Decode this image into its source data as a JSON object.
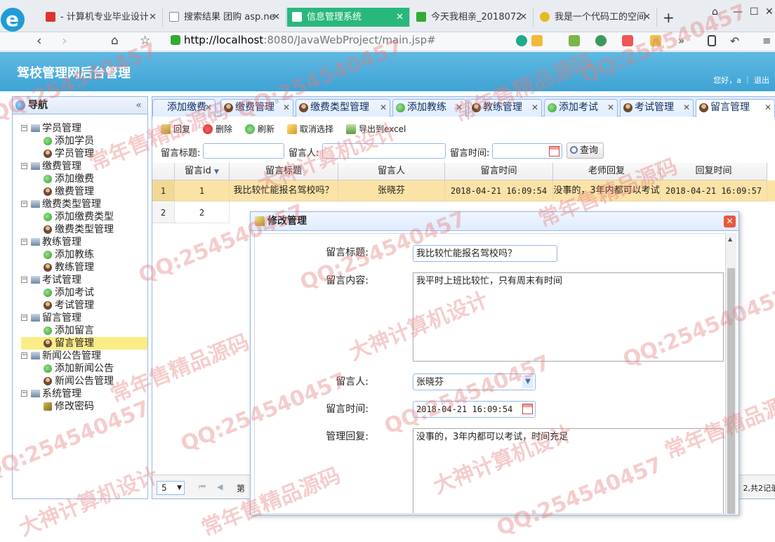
{
  "browser": {
    "tabs": [
      {
        "label": "- 计算机专业毕业设计",
        "fav_color": "#d33"
      },
      {
        "label": "搜索结果 团购 asp.ne",
        "fav_color": "#888"
      },
      {
        "label": "信息管理系统",
        "fav_color": "#fff"
      },
      {
        "label": "今天我相亲_2018072",
        "fav_color": "#3a3"
      },
      {
        "label": "我是一个代码工的空间",
        "fav_color": "#e8b820"
      }
    ],
    "url_host": "http://localhost",
    "url_rest": ":8080/JavaWebProject/main.jsp#",
    "new_tab": "+"
  },
  "app": {
    "title": "驾校管理网后台管理",
    "greeting": "您好，a ｜ 退出"
  },
  "nav": {
    "title": "导航",
    "collapse": "«",
    "groups": [
      {
        "label": "学员管理",
        "items": [
          {
            "label": "添加学员",
            "icon": "add"
          },
          {
            "label": "学员管理",
            "icon": "user"
          }
        ]
      },
      {
        "label": "缴费管理",
        "items": [
          {
            "label": "添加缴费",
            "icon": "add"
          },
          {
            "label": "缴费管理",
            "icon": "user"
          }
        ]
      },
      {
        "label": "缴费类型管理",
        "items": [
          {
            "label": "添加缴费类型",
            "icon": "add"
          },
          {
            "label": "缴费类型管理",
            "icon": "user"
          }
        ]
      },
      {
        "label": "教练管理",
        "items": [
          {
            "label": "添加教练",
            "icon": "add"
          },
          {
            "label": "教练管理",
            "icon": "user"
          }
        ]
      },
      {
        "label": "考试管理",
        "items": [
          {
            "label": "添加考试",
            "icon": "add"
          },
          {
            "label": "考试管理",
            "icon": "user"
          }
        ]
      },
      {
        "label": "留言管理",
        "items": [
          {
            "label": "添加留言",
            "icon": "add"
          },
          {
            "label": "留言管理",
            "icon": "user",
            "selected": true
          }
        ]
      },
      {
        "label": "新闻公告管理",
        "items": [
          {
            "label": "添加新闻公告",
            "icon": "add"
          },
          {
            "label": "新闻公告管理",
            "icon": "user"
          }
        ]
      },
      {
        "label": "系统管理",
        "items": [
          {
            "label": "修改密码",
            "icon": "pen"
          }
        ]
      }
    ]
  },
  "content_tabs": [
    {
      "label": "添加缴费",
      "icon": "add"
    },
    {
      "label": "缴费管理",
      "icon": "user"
    },
    {
      "label": "缴费类型管理",
      "icon": "user"
    },
    {
      "label": "添加教练",
      "icon": "add"
    },
    {
      "label": "教练管理",
      "icon": "user"
    },
    {
      "label": "添加考试",
      "icon": "add"
    },
    {
      "label": "考试管理",
      "icon": "user"
    },
    {
      "label": "留言管理",
      "icon": "user",
      "active": true
    }
  ],
  "toolbar": {
    "reply": "回复",
    "delete": "删除",
    "refresh": "刷新",
    "unselect": "取消选择",
    "export": "导出到excel"
  },
  "filters": {
    "title_label": "留言标题:",
    "author_label": "留言人:",
    "time_label": "留言时间:",
    "search": "查询"
  },
  "grid": {
    "columns": [
      "留言id",
      "留言标题",
      "留言人",
      "留言时间",
      "老师回复",
      "回复时间"
    ],
    "rows": [
      {
        "num": "1",
        "id": "1",
        "title": "我比较忙能报名驾校吗？",
        "author": "张晓芬",
        "time": "2018-04-21 16:09:54",
        "reply": "没事的，3年内都可以考试",
        "reply_time": "2018-04-21 16:09:57"
      },
      {
        "num": "2",
        "id": "2"
      }
    ]
  },
  "pager": {
    "page_size": "5",
    "page_prefix": "第",
    "summary": "2,共2记录"
  },
  "modal": {
    "title": "修改管理",
    "close": "✕",
    "fields": {
      "title_label": "留言标题:",
      "title_value": "我比较忙能报名驾校吗？",
      "content_label": "留言内容:",
      "content_value": "我平时上班比较忙，只有周末有时间",
      "author_label": "留言人:",
      "author_value": "张晓芬",
      "time_label": "留言时间:",
      "time_value": "2018-04-21 16:09:54",
      "reply_label": "管理回复:",
      "reply_value": "没事的，3年内都可以考试，时间充足"
    }
  },
  "watermarks": {
    "qq": "QQ:254540457",
    "design": "大神计算机设计",
    "source": "常年售精品源码"
  }
}
